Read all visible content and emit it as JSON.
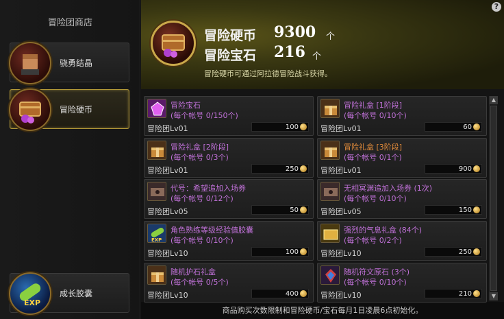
{
  "sidebar": {
    "title": "冒险团商店",
    "items": [
      {
        "label": "骁勇结晶",
        "icon": "fist-icon"
      },
      {
        "label": "冒险硬币",
        "icon": "treasure-chest-icon"
      },
      {
        "label": "成长胶囊",
        "icon": "exp-capsule-icon"
      }
    ]
  },
  "header": {
    "coin_label": "冒险硬币",
    "coin_value": "9300",
    "coin_unit": "个",
    "gem_label": "冒险宝石",
    "gem_value": "216",
    "gem_unit": "个",
    "description": "冒险硬币可通过阿拉德冒险战斗获得。",
    "help": "?"
  },
  "items": [
    {
      "name": "冒险宝石",
      "limit": "(每个帐号 0/150个)",
      "level": "冒险团Lv01",
      "price": "100",
      "name_color": "#c071d8",
      "icon": "purple-gem-icon"
    },
    {
      "name": "冒险礼盒 [1阶段]",
      "limit": "(每个帐号 0/10个)",
      "level": "冒险团Lv01",
      "price": "60",
      "name_color": "#c071d8",
      "icon": "gift-box-icon"
    },
    {
      "name": "冒险礼盒 [2阶段]",
      "limit": "(每个帐号 0/3个)",
      "level": "冒险团Lv01",
      "price": "250",
      "name_color": "#c071d8",
      "icon": "gift-box-icon"
    },
    {
      "name": "冒险礼盒 [3阶段]",
      "limit": "(每个帐号 0/1个)",
      "level": "冒险团Lv01",
      "price": "900",
      "name_color": "#e08a3a",
      "icon": "gift-box-icon"
    },
    {
      "name": "代号：希望追加入场券",
      "limit": "(每个帐号 0/12个)",
      "level": "冒险团Lv05",
      "price": "50",
      "name_color": "#c071d8",
      "icon": "ticket-icon"
    },
    {
      "name": "无相冥渊追加入场券 (1次)",
      "limit": "(每个帐号 0/10个)",
      "level": "冒险团Lv05",
      "price": "150",
      "name_color": "#c071d8",
      "icon": "ticket-icon"
    },
    {
      "name": "角色熟练等级经验值胶囊",
      "limit": "(每个帐号 0/10个)",
      "level": "冒险团Lv10",
      "price": "100",
      "name_color": "#c071d8",
      "icon": "exp-capsule-icon"
    },
    {
      "name": "强烈的气息礼盒 (84个)",
      "limit": "(每个帐号 0/2个)",
      "level": "冒险团Lv10",
      "price": "250",
      "name_color": "#c071d8",
      "icon": "gold-chest-icon"
    },
    {
      "name": "随机护石礼盒",
      "limit": "(每个帐号 0/5个)",
      "level": "冒险团Lv10",
      "price": "400",
      "name_color": "#c071d8",
      "icon": "gift-box-icon"
    },
    {
      "name": "随机符文原石 (3个)",
      "limit": "(每个帐号 0/10个)",
      "level": "冒险团Lv10",
      "price": "210",
      "name_color": "#c071d8",
      "icon": "rune-stone-icon"
    }
  ],
  "footer": "商品购买次数限制和冒险硬币/宝石每月1日凌晨6点初始化。",
  "scrollbar": {
    "up": "▲",
    "down": "▼"
  },
  "colors": {
    "accent_gold": "#c9a84a",
    "limit_purple": "#c071d8",
    "item_orange": "#e08a3a"
  }
}
